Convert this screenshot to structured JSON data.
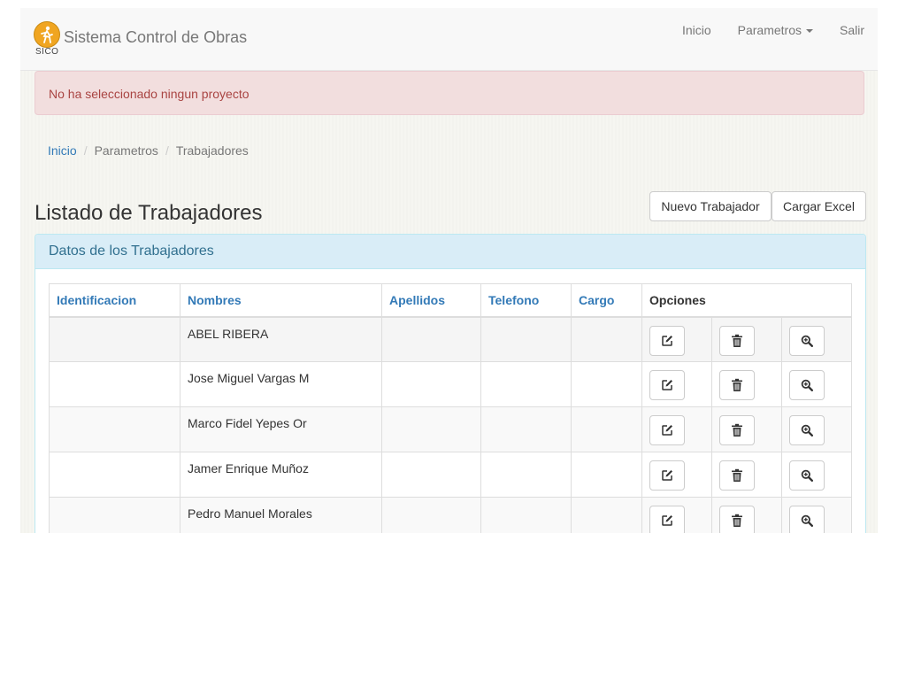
{
  "navbar": {
    "logo_sub": "SICO",
    "brand_title": "Sistema Control de Obras",
    "items": [
      "Inicio",
      "Parametros",
      "Salir"
    ]
  },
  "alert": {
    "message": "No ha seleccionado ningun proyecto"
  },
  "breadcrumb": [
    "Inicio",
    "Parametros",
    "Trabajadores"
  ],
  "page": {
    "title": "Listado de Trabajadores",
    "new_button": "Nuevo Trabajador",
    "excel_button": "Cargar Excel"
  },
  "panel": {
    "title": "Datos de los Trabajadores"
  },
  "table": {
    "headers": [
      "Identificacion",
      "Nombres",
      "Apellidos",
      "Telefono",
      "Cargo",
      "Opciones"
    ],
    "rows": [
      {
        "identificacion": "",
        "nombres": "ABEL RIBERA",
        "apellidos": "",
        "telefono": "",
        "cargo": ""
      },
      {
        "identificacion": "",
        "nombres": "Jose Miguel Vargas M",
        "apellidos": "",
        "telefono": "",
        "cargo": ""
      },
      {
        "identificacion": "",
        "nombres": "Marco Fidel Yepes Or",
        "apellidos": "",
        "telefono": "",
        "cargo": ""
      },
      {
        "identificacion": "",
        "nombres": "Jamer Enrique Muñoz",
        "apellidos": "",
        "telefono": "",
        "cargo": ""
      },
      {
        "identificacion": "",
        "nombres": "Pedro Manuel Morales",
        "apellidos": "",
        "telefono": "",
        "cargo": ""
      }
    ],
    "option_icons": [
      "edit-icon",
      "trash-icon",
      "zoom-in-icon"
    ]
  },
  "colors": {
    "link": "#337ab7",
    "alert_bg": "#f2dede",
    "alert_text": "#a94442",
    "panel_heading_bg": "#d9edf7",
    "panel_heading_text": "#31708f",
    "logo": "#f0a521"
  }
}
